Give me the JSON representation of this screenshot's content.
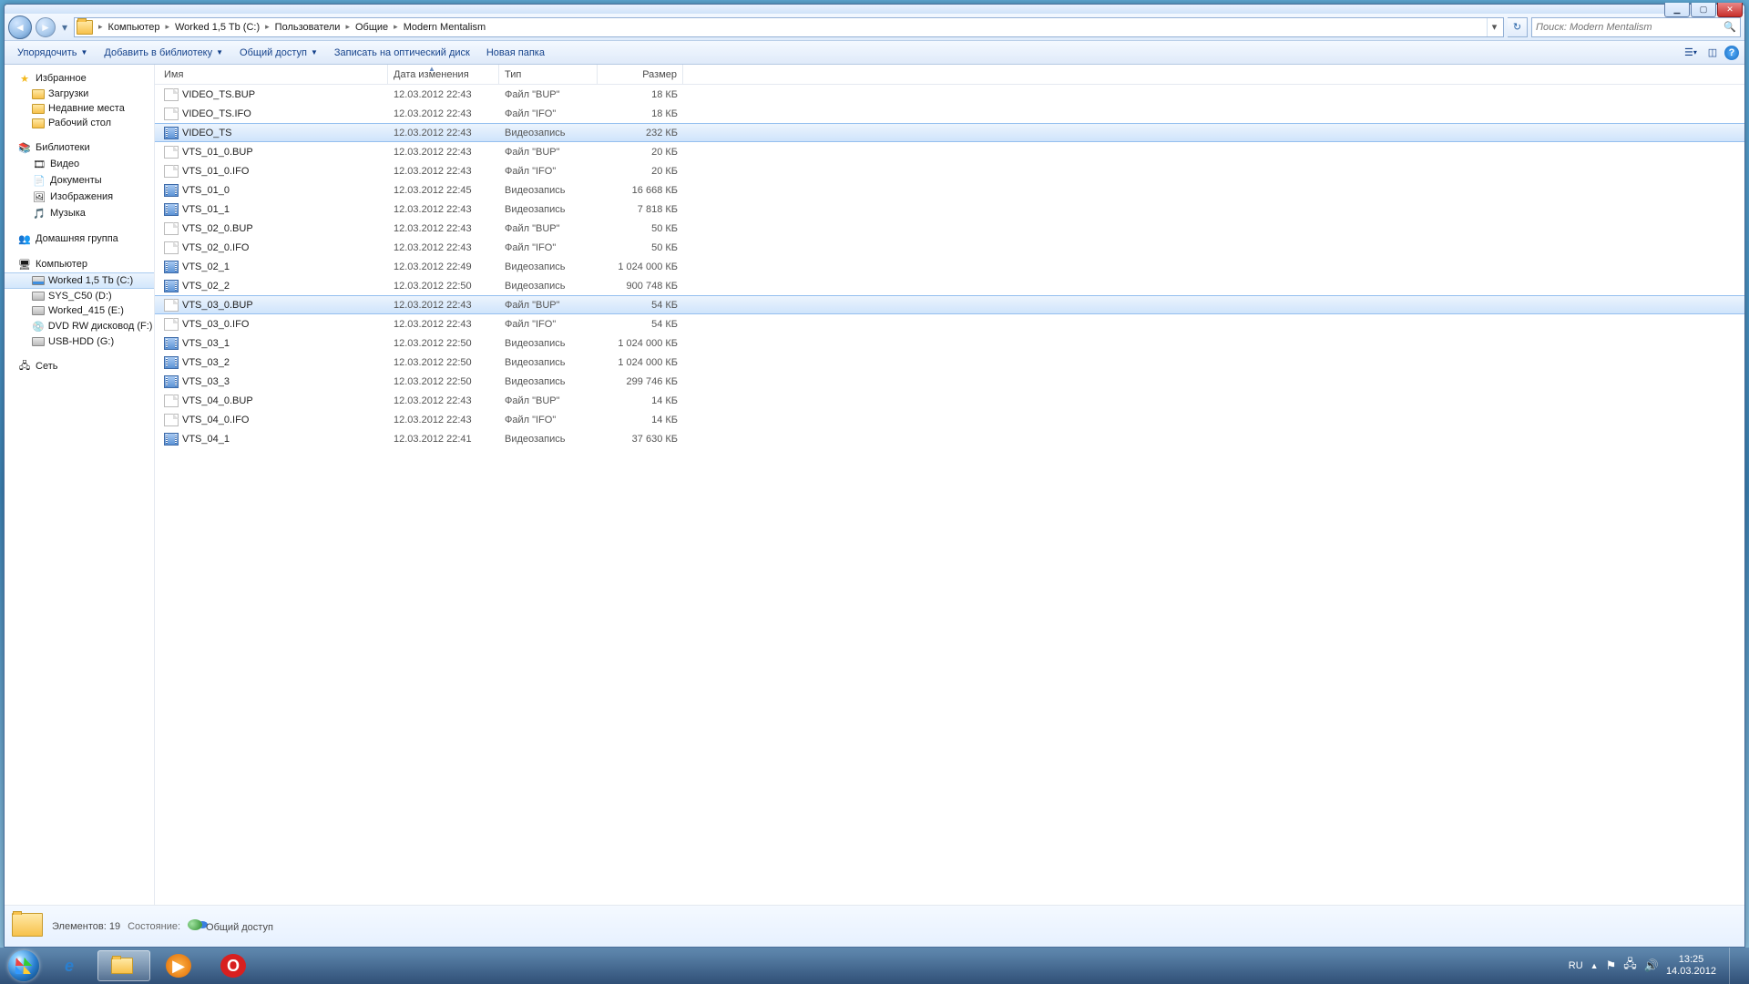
{
  "window_controls": {
    "min": "▁",
    "max": "▢",
    "close": "✕"
  },
  "breadcrumbs": [
    "Компьютер",
    "Worked 1,5 Tb (C:)",
    "Пользователи",
    "Общие",
    "Modern Mentalism"
  ],
  "search": {
    "placeholder": "Поиск: Modern Mentalism"
  },
  "cmdbar": {
    "organize": "Упорядочить",
    "addlib": "Добавить в библиотеку",
    "share": "Общий доступ",
    "burn": "Записать на оптический диск",
    "newfolder": "Новая папка"
  },
  "navpane": {
    "favorites": {
      "head": "Избранное",
      "items": [
        "Загрузки",
        "Недавние места",
        "Рабочий стол"
      ]
    },
    "libraries": {
      "head": "Библиотеки",
      "items": [
        "Видео",
        "Документы",
        "Изображения",
        "Музыка"
      ]
    },
    "homegroup": {
      "head": "Домашняя группа"
    },
    "computer": {
      "head": "Компьютер",
      "items": [
        "Worked 1,5 Tb (C:)",
        "SYS_C50 (D:)",
        "Worked_415 (E:)",
        "DVD RW дисковод (F:)",
        "USB-HDD (G:)"
      ]
    },
    "network": {
      "head": "Сеть"
    }
  },
  "columns": {
    "name": "Имя",
    "date": "Дата изменения",
    "type": "Тип",
    "size": "Размер"
  },
  "rows": [
    {
      "icon": "generic",
      "name": "VIDEO_TS.BUP",
      "date": "12.03.2012 22:43",
      "type": "Файл \"BUP\"",
      "size": "18 КБ",
      "sel": false
    },
    {
      "icon": "generic",
      "name": "VIDEO_TS.IFO",
      "date": "12.03.2012 22:43",
      "type": "Файл \"IFO\"",
      "size": "18 КБ",
      "sel": false
    },
    {
      "icon": "video",
      "name": "VIDEO_TS",
      "date": "12.03.2012 22:43",
      "type": "Видеозапись",
      "size": "232 КБ",
      "sel": true
    },
    {
      "icon": "generic",
      "name": "VTS_01_0.BUP",
      "date": "12.03.2012 22:43",
      "type": "Файл \"BUP\"",
      "size": "20 КБ",
      "sel": false
    },
    {
      "icon": "generic",
      "name": "VTS_01_0.IFO",
      "date": "12.03.2012 22:43",
      "type": "Файл \"IFO\"",
      "size": "20 КБ",
      "sel": false
    },
    {
      "icon": "video",
      "name": "VTS_01_0",
      "date": "12.03.2012 22:45",
      "type": "Видеозапись",
      "size": "16 668 КБ",
      "sel": false
    },
    {
      "icon": "video",
      "name": "VTS_01_1",
      "date": "12.03.2012 22:43",
      "type": "Видеозапись",
      "size": "7 818 КБ",
      "sel": false
    },
    {
      "icon": "generic",
      "name": "VTS_02_0.BUP",
      "date": "12.03.2012 22:43",
      "type": "Файл \"BUP\"",
      "size": "50 КБ",
      "sel": false
    },
    {
      "icon": "generic",
      "name": "VTS_02_0.IFO",
      "date": "12.03.2012 22:43",
      "type": "Файл \"IFO\"",
      "size": "50 КБ",
      "sel": false
    },
    {
      "icon": "video",
      "name": "VTS_02_1",
      "date": "12.03.2012 22:49",
      "type": "Видеозапись",
      "size": "1 024 000 КБ",
      "sel": false
    },
    {
      "icon": "video",
      "name": "VTS_02_2",
      "date": "12.03.2012 22:50",
      "type": "Видеозапись",
      "size": "900 748 КБ",
      "sel": false
    },
    {
      "icon": "generic",
      "name": "VTS_03_0.BUP",
      "date": "12.03.2012 22:43",
      "type": "Файл \"BUP\"",
      "size": "54 КБ",
      "sel": true
    },
    {
      "icon": "generic",
      "name": "VTS_03_0.IFO",
      "date": "12.03.2012 22:43",
      "type": "Файл \"IFO\"",
      "size": "54 КБ",
      "sel": false
    },
    {
      "icon": "video",
      "name": "VTS_03_1",
      "date": "12.03.2012 22:50",
      "type": "Видеозапись",
      "size": "1 024 000 КБ",
      "sel": false
    },
    {
      "icon": "video",
      "name": "VTS_03_2",
      "date": "12.03.2012 22:50",
      "type": "Видеозапись",
      "size": "1 024 000 КБ",
      "sel": false
    },
    {
      "icon": "video",
      "name": "VTS_03_3",
      "date": "12.03.2012 22:50",
      "type": "Видеозапись",
      "size": "299 746 КБ",
      "sel": false
    },
    {
      "icon": "generic",
      "name": "VTS_04_0.BUP",
      "date": "12.03.2012 22:43",
      "type": "Файл \"BUP\"",
      "size": "14 КБ",
      "sel": false
    },
    {
      "icon": "generic",
      "name": "VTS_04_0.IFO",
      "date": "12.03.2012 22:43",
      "type": "Файл \"IFO\"",
      "size": "14 КБ",
      "sel": false
    },
    {
      "icon": "video",
      "name": "VTS_04_1",
      "date": "12.03.2012 22:41",
      "type": "Видеозапись",
      "size": "37 630 КБ",
      "sel": false
    }
  ],
  "details": {
    "count_label": "Элементов: 19",
    "state_label": "Состояние:",
    "state_value": "Общий доступ"
  },
  "tray": {
    "lang": "RU",
    "time": "13:25",
    "date": "14.03.2012"
  }
}
